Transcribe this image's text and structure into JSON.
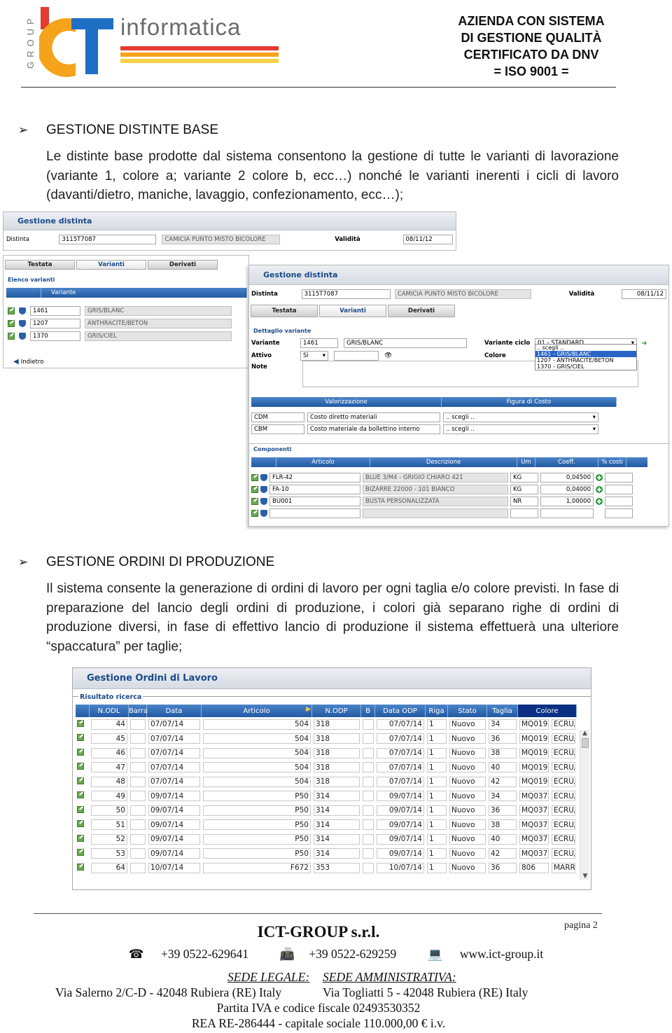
{
  "header": {
    "group_vertical": "GROUP",
    "logo_word": "informatica",
    "cert_lines": [
      "AZIENDA CON SISTEMA",
      "DI GESTIONE QUALITÀ",
      "CERTIFICATO DA DNV",
      "= ISO 9001 ="
    ]
  },
  "section1": {
    "bullet": "➢",
    "heading": "GESTIONE DISTINTE BASE",
    "paragraph": "Le distinte base prodotte dal sistema consentono la gestione di tutte le varianti di lavorazione (variante 1, colore a; variante 2 colore b, ecc…) nonché le varianti inerenti i cicli di lavoro (davanti/dietro, maniche, lavaggio, confezionamento, ecc…);"
  },
  "shot1": {
    "title": "Gestione distinta",
    "distinta_label": "Distinta",
    "distinta_code": "3115T7087",
    "distinta_desc": "CAMICIA PUNTO MISTO BICOLORE",
    "validita_label": "Validità",
    "validita_value": "08/11/12",
    "tabs": [
      "Testata",
      "Varianti",
      "Derivati"
    ],
    "elenco_legend": "Elenco varianti",
    "variante_col": "Variante",
    "rows": [
      {
        "code": "1461",
        "desc": "GRIS/BLANC"
      },
      {
        "code": "1207",
        "desc": "ANTHRACITE/BETON"
      },
      {
        "code": "1370",
        "desc": "GRIS/CIEL"
      }
    ],
    "back_label": "Indietro"
  },
  "shot2": {
    "title": "Gestione distinta",
    "distinta_label": "Distinta",
    "distinta_code": "3115T7087",
    "distinta_desc": "CAMICIA PUNTO MISTO BICOLORE",
    "validita_label": "Validità",
    "validita_value": "08/11/12",
    "tabs": [
      "Testata",
      "Varianti",
      "Derivati"
    ],
    "dettaglio_legend": "Dettaglio variante",
    "variante_label": "Variante",
    "variante_code": "1461",
    "variante_desc": "GRIS/BLANC",
    "attivo_label": "Attivo",
    "attivo_value": "Sì",
    "note_label": "Note",
    "ciclo_label": "Variante ciclo",
    "ciclo_value": "01 - STANDARD",
    "colore_label": "Colore",
    "colore_options": [
      ".. scegli ..",
      "1461 - GRIS/BLANC",
      "1207 - ANTHRACITE/BETON",
      "1370 - GRIS/CIEL"
    ],
    "valor_head": "Valorizzazione",
    "figura_head": "Figura di Costo",
    "cost_rows": [
      {
        "code": "CDM",
        "desc": "Costo diretto materiali",
        "sel": ".. scegli .."
      },
      {
        "code": "CBM",
        "desc": "Costo materiale da bollettino interno",
        "sel": ".. scegli .."
      }
    ],
    "comp_legend": "Componenti",
    "comp_cols": [
      "Articolo",
      "Descrizione",
      "Um",
      "Coeff.",
      "% costi"
    ],
    "comp_rows": [
      {
        "art": "FLR-42",
        "desc": "BLUE 3/M4 - GRIGIO CHIARO 421",
        "um": "KG",
        "coeff": "0,04500"
      },
      {
        "art": "FA-10",
        "desc": "BIZARRE 22000 - 101 BIANCO",
        "um": "KG",
        "coeff": "0,04000"
      },
      {
        "art": "BU001",
        "desc": "BUSTA PERSONALIZZATA",
        "um": "NR",
        "coeff": "1,00000"
      },
      {
        "art": "",
        "desc": "",
        "um": "",
        "coeff": ""
      }
    ]
  },
  "section2": {
    "bullet": "➢",
    "heading": "GESTIONE ORDINI DI PRODUZIONE",
    "paragraph": "Il sistema consente la generazione di ordini di lavoro per ogni taglia e/o colore previsti. In fase di preparazione del lancio degli ordini di produzione, i colori già separano righe di ordini di produzione diversi, in fase di effettivo lancio di produzione il sistema effettuerà una ulteriore “spaccatura” per taglie;"
  },
  "orders": {
    "title": "Gestione Ordini di Lavoro",
    "legend": "Risultato ricerca",
    "columns": [
      "N.ODL",
      "Barra",
      "Data",
      "Articolo",
      "N.ODP",
      "B",
      "Data ODP",
      "Riga",
      "Stato",
      "Taglia",
      "Colore"
    ],
    "rows": [
      [
        "44",
        "",
        "07/07/14",
        "504",
        "318",
        "",
        "07/07/14",
        "1",
        "Nuovo",
        "34",
        "MQ019",
        "ECRU/"
      ],
      [
        "45",
        "",
        "07/07/14",
        "504",
        "318",
        "",
        "07/07/14",
        "1",
        "Nuovo",
        "36",
        "MQ019",
        "ECRU/"
      ],
      [
        "46",
        "",
        "07/07/14",
        "504",
        "318",
        "",
        "07/07/14",
        "1",
        "Nuovo",
        "38",
        "MQ019",
        "ECRU/"
      ],
      [
        "47",
        "",
        "07/07/14",
        "504",
        "318",
        "",
        "07/07/14",
        "1",
        "Nuovo",
        "40",
        "MQ019",
        "ECRU/"
      ],
      [
        "48",
        "",
        "07/07/14",
        "504",
        "318",
        "",
        "07/07/14",
        "1",
        "Nuovo",
        "42",
        "MQ019",
        "ECRU/"
      ],
      [
        "49",
        "",
        "09/07/14",
        "P50",
        "314",
        "",
        "09/07/14",
        "1",
        "Nuovo",
        "34",
        "MQ037",
        "ECRU/"
      ],
      [
        "50",
        "",
        "09/07/14",
        "P50",
        "314",
        "",
        "09/07/14",
        "1",
        "Nuovo",
        "36",
        "MQ037",
        "ECRU/"
      ],
      [
        "51",
        "",
        "09/07/14",
        "P50",
        "314",
        "",
        "09/07/14",
        "1",
        "Nuovo",
        "38",
        "MQ037",
        "ECRU/"
      ],
      [
        "52",
        "",
        "09/07/14",
        "P50",
        "314",
        "",
        "09/07/14",
        "1",
        "Nuovo",
        "40",
        "MQ037",
        "ECRU/"
      ],
      [
        "53",
        "",
        "09/07/14",
        "P50",
        "314",
        "",
        "09/07/14",
        "1",
        "Nuovo",
        "42",
        "MQ037",
        "ECRU/"
      ],
      [
        "64",
        "",
        "10/07/14",
        "F672",
        "353",
        "",
        "10/07/14",
        "1",
        "Nuovo",
        "36",
        "806",
        "MARR("
      ]
    ]
  },
  "footer": {
    "page": "pagina 2",
    "company": "ICT-GROUP s.r.l.",
    "phone": "+39 0522-629641",
    "fax": "+39 0522-629259",
    "web": "www.ict-group.it",
    "sede_legale_label": "SEDE LEGALE:",
    "sede_amm_label": "SEDE AMMINISTRATIVA:",
    "sede_legale": "Via Salerno 2/C-D - 42048 Rubiera (RE) Italy",
    "sede_amm": "Via Togliatti 5 - 42048 Rubiera (RE) Italy",
    "piva": "Partita IVA e codice fiscale 02493530352",
    "rea": "REA  RE-286444  -  capitale sociale 110.000,00 € i.v."
  },
  "colors": {
    "brand_orange": "#f5a31a",
    "brand_blue": "#1f6fc4",
    "ui_blue": "#225aa3",
    "title_blue": "#1a4a8a"
  }
}
